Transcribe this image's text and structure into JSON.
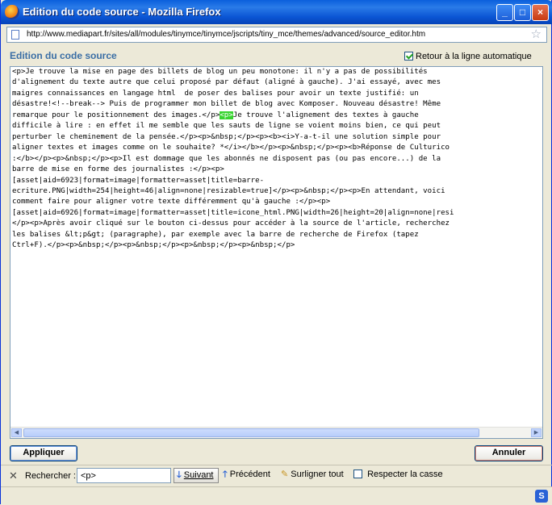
{
  "window": {
    "title": "Edition du code source - Mozilla Firefox",
    "controls": {
      "minimize": "_",
      "maximize": "□",
      "close": "×"
    }
  },
  "address_bar": {
    "url": "http://www.mediapart.fr/sites/all/modules/tinymce/tinymce/jscripts/tiny_mce/themes/advanced/source_editor.htm",
    "star_glyph": "☆"
  },
  "dialog": {
    "heading": "Edition du code source",
    "wrap_checkbox": {
      "label": "Retour à la ligne automatique",
      "checked": true
    }
  },
  "editor": {
    "lines": [
      {
        "text": "<p>Je trouve la mise en page des billets de blog un peu monotone: il n'y a pas de possibilités"
      },
      {
        "text": "d'alignement du texte autre que celui proposé par défaut (aligné à gauche). J'ai essayé, avec mes"
      },
      {
        "text": "maigres connaissances en langage html  de poser des balises pour avoir un texte justifié: un"
      },
      {
        "text": "désastre!<!--break--> Puis de programmer mon billet de blog avec Komposer. Nouveau désastre! Même"
      },
      {
        "before": "remarque pour le positionnement des images.</p>",
        "highlight": "<p>",
        "after": "Je trouve l'alignement des textes à gauche"
      },
      {
        "text": "difficile à lire : en effet il me semble que les sauts de ligne se voient moins bien, ce qui peut"
      },
      {
        "text": "perturber le cheminement de la pensée.</p><p>&nbsp;</p><p><b><i>Y-a-t-il une solution simple pour"
      },
      {
        "text": "aligner textes et images comme on le souhaite? *</i></b></p><p>&nbsp;</p><p><b>Réponse de Culturico"
      },
      {
        "text": ":</b></p><p>&nbsp;</p><p>Il est dommage que les abonnés ne disposent pas (ou pas encore...) de la"
      },
      {
        "text": "barre de mise en forme des journalistes :</p><p>"
      },
      {
        "text": "[asset|aid=6923|format=image|formatter=asset|title=barre-"
      },
      {
        "text": "ecriture.PNG|width=254|height=46|align=none|resizable=true]</p><p>&nbsp;</p><p>En attendant, voici"
      },
      {
        "text": "comment faire pour aligner votre texte différemment qu'à gauche :</p><p>"
      },
      {
        "text": "[asset|aid=6926|format=image|formatter=asset|title=icone_html.PNG|width=26|height=20|align=none|resi"
      },
      {
        "text": "</p><p>Après avoir cliqué sur le bouton ci-dessus pour accéder à la source de l'article, recherchez"
      },
      {
        "text": "les balises &lt;p&gt; (paragraphe), par exemple avec la barre de recherche de Firefox (tapez"
      },
      {
        "text": "Ctrl+F).</p><p>&nbsp;</p><p>&nbsp;</p><p>&nbsp;</p><p>&nbsp;</p>"
      }
    ]
  },
  "buttons": {
    "apply": "Appliquer",
    "cancel": "Annuler"
  },
  "findbar": {
    "close": "✕",
    "label": "Rechercher :",
    "value": "<p>",
    "next": "Suivant",
    "previous": "Précédent",
    "highlight_all": "Surligner tout",
    "match_case": "Respecter la casse"
  },
  "statusbar": {
    "icon_letter": "S"
  }
}
